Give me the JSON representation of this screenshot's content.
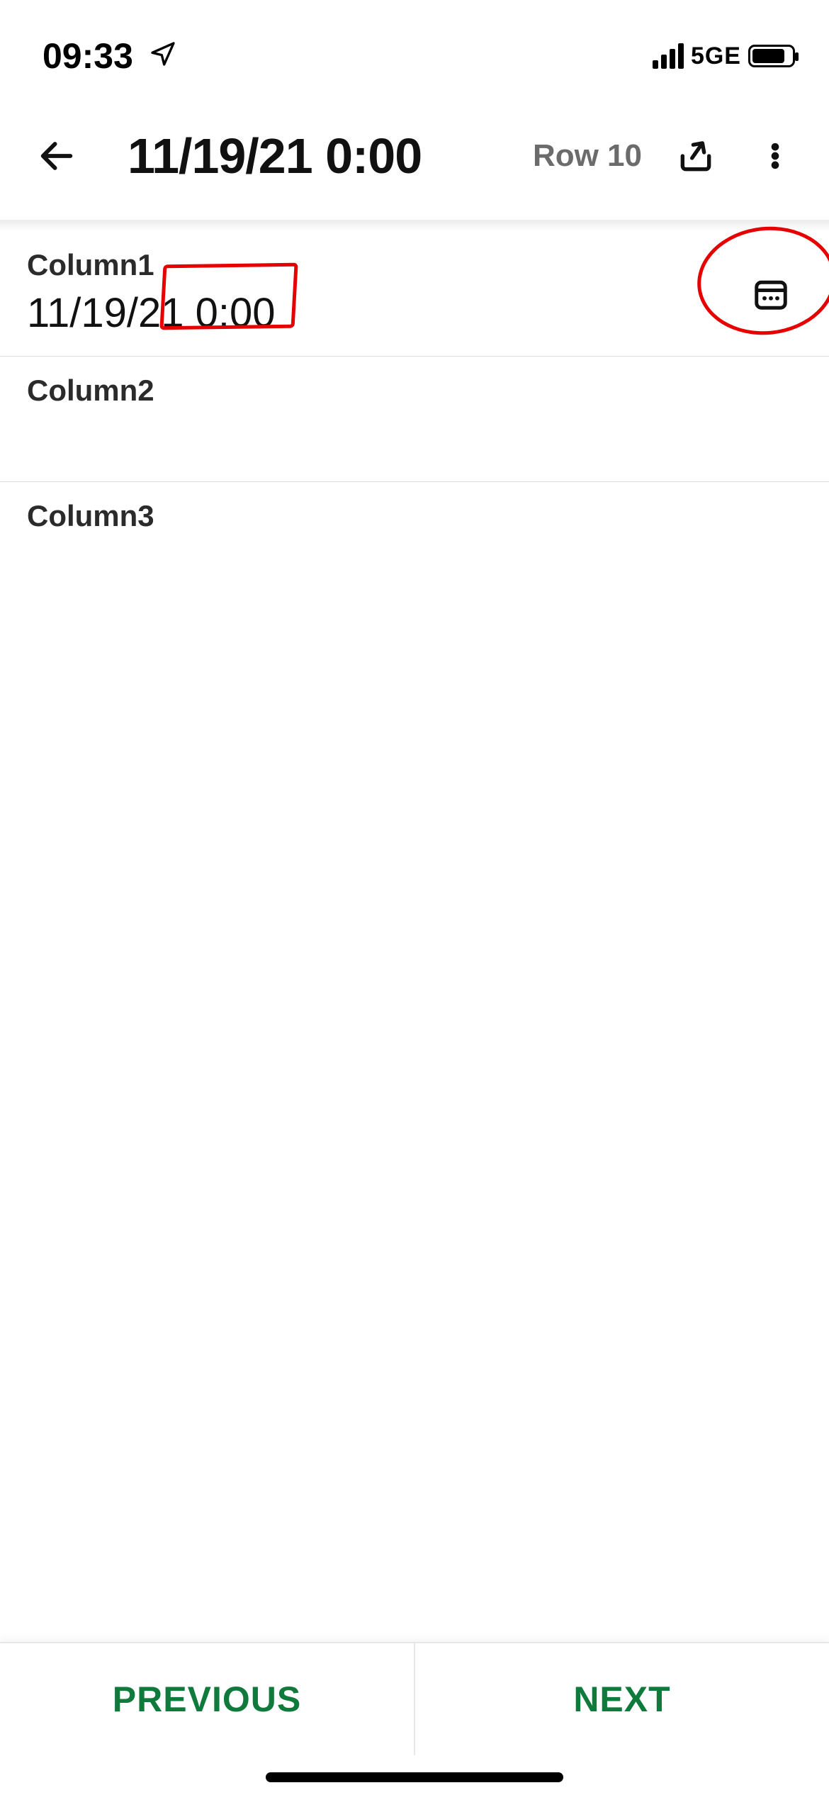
{
  "status_bar": {
    "time": "09:33",
    "network": "5GE"
  },
  "app_bar": {
    "title": "11/19/21 0:00",
    "row_indicator": "Row 10"
  },
  "fields": [
    {
      "label": "Column1",
      "value": "11/19/21 0:00",
      "has_picker": true
    },
    {
      "label": "Column2",
      "value": "",
      "has_picker": false
    },
    {
      "label": "Column3",
      "value": "",
      "has_picker": false
    }
  ],
  "bottom_bar": {
    "previous": "PREVIOUS",
    "next": "NEXT"
  }
}
